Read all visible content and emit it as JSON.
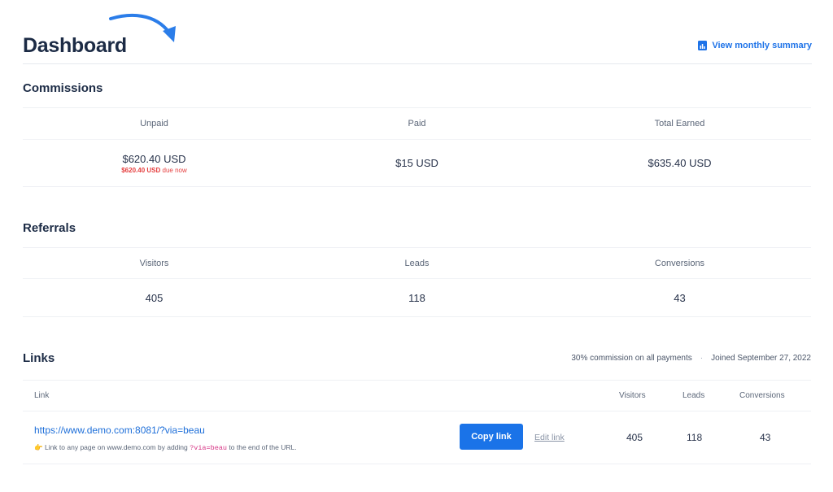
{
  "header": {
    "title": "Dashboard",
    "summary_link": "View monthly summary"
  },
  "commissions": {
    "title": "Commissions",
    "columns": [
      "Unpaid",
      "Paid",
      "Total Earned"
    ],
    "unpaid": "$620.40 USD",
    "due_amount": "$620.40 USD",
    "due_text": "due now",
    "paid": "$15 USD",
    "total": "$635.40 USD"
  },
  "referrals": {
    "title": "Referrals",
    "columns": [
      "Visitors",
      "Leads",
      "Conversions"
    ],
    "values": [
      "405",
      "118",
      "43"
    ]
  },
  "links": {
    "title": "Links",
    "commission_note": "30% commission on all payments",
    "separator": "·",
    "joined": "Joined September 27, 2022",
    "columns": {
      "link": "Link",
      "visitors": "Visitors",
      "leads": "Leads",
      "conversions": "Conversions"
    },
    "row": {
      "url": "https://www.demo.com:8081/?via=beau",
      "hint_emoji": "👉",
      "hint_before": "Link to any page on www.demo.com by adding",
      "hint_param": "?via=beau",
      "hint_after": "to the end of the URL.",
      "copy_label": "Copy link",
      "edit_label": "Edit link",
      "visitors": "405",
      "leads": "118",
      "conversions": "43"
    }
  },
  "colors": {
    "accent": "#1a73e8",
    "heading": "#1c2b45",
    "due": "#e53e3e"
  }
}
